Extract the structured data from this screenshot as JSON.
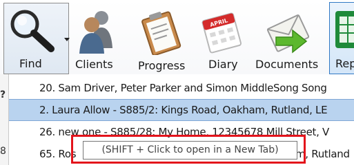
{
  "ribbon": {
    "find": {
      "label": "Find",
      "icon": "magnifier-icon"
    },
    "clients": {
      "label": "Clients",
      "icon": "people-icon"
    },
    "progress": {
      "label": "Progress",
      "icon": "clipboard-icon"
    },
    "diary": {
      "label": "Diary",
      "icon": "calendar-icon",
      "calendar_month": "APRIL"
    },
    "documents": {
      "label": "Documents",
      "icon": "envelope-arrow-icon"
    },
    "reports": {
      "label": "Rep",
      "icon": "spreadsheet-icon"
    }
  },
  "left_strip": {
    "glyph_top": "?",
    "glyph_bottom": "8"
  },
  "list": {
    "items": [
      {
        "text": "20. Sam Driver, Peter Parker and Simon MiddleSong Song",
        "selected": false
      },
      {
        "text": "2. Laura Allow - S885/2: Kings Road, Oakham, Rutland, LE",
        "selected": true
      },
      {
        "text": "26. new one - S885/28: My Home, 12345678 Mill Street, V",
        "selected": false
      },
      {
        "text": "65. Ros",
        "tail": "m, Rutland",
        "selected": false
      }
    ]
  },
  "tooltip": {
    "text": "(SHIFT + Click to open in a New Tab)"
  },
  "colors": {
    "selection": "#b9d3ef",
    "highlight": "#e3131b",
    "find_button_border": "#8c8c8c",
    "reports_button_border": "#2f78c4"
  }
}
